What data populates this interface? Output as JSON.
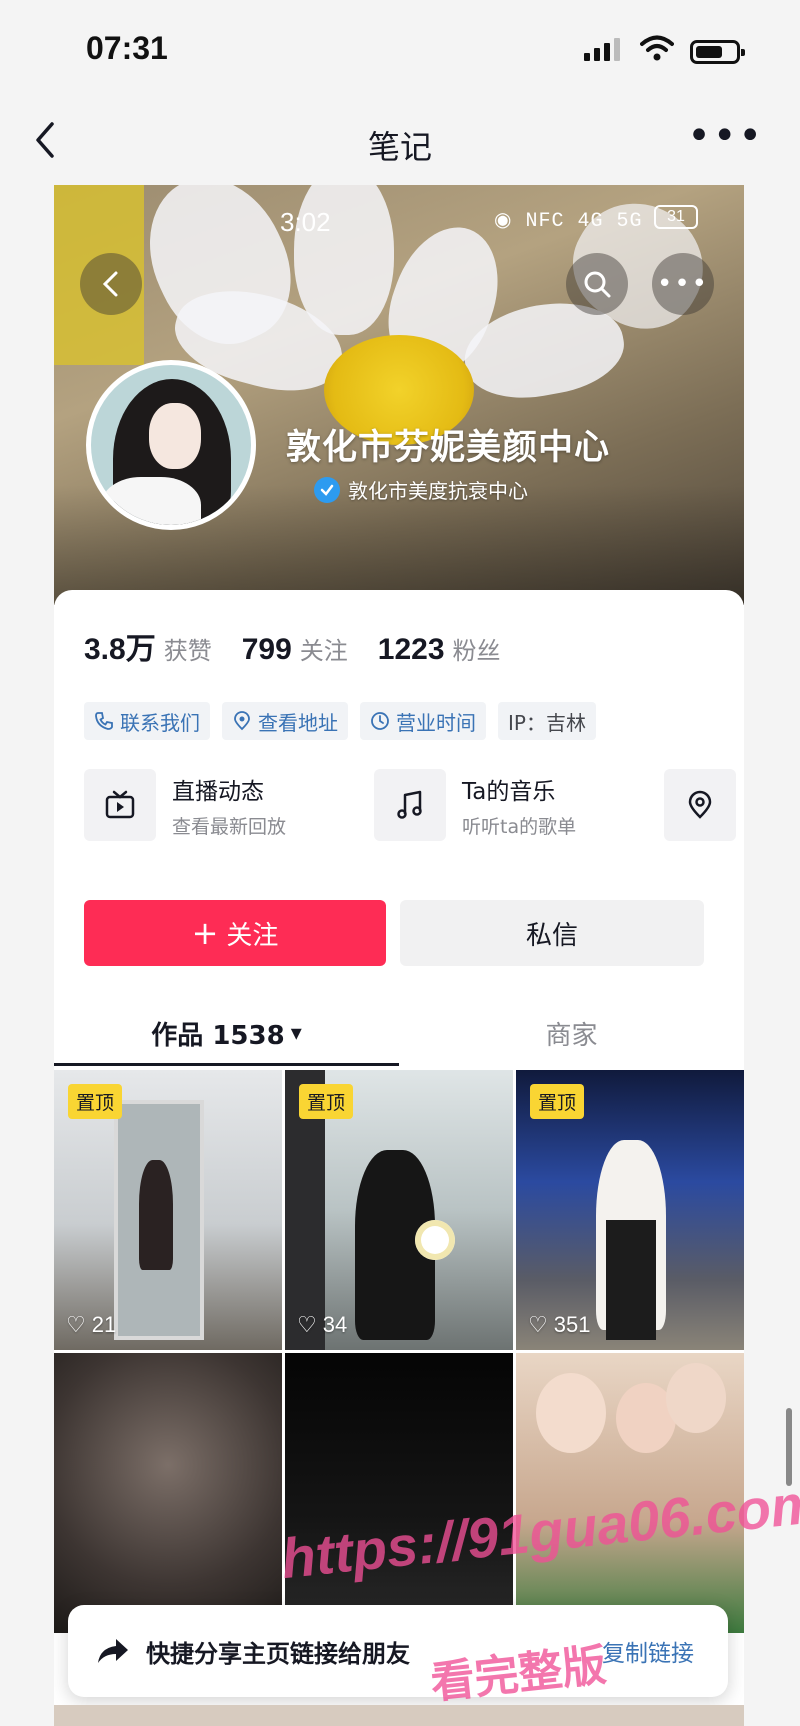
{
  "status_bar": {
    "time": "07:31"
  },
  "nav": {
    "title": "笔记"
  },
  "banner": {
    "inner_time": "3:02",
    "inner_icons": "◉ NFC 4G 5G",
    "inner_battery": "31"
  },
  "profile": {
    "name": "敦化市芬妮美颜中心",
    "verified_label": "敦化市美度抗衰中心"
  },
  "stats": [
    {
      "value": "3.8万",
      "label": "获赞"
    },
    {
      "value": "799",
      "label": "关注"
    },
    {
      "value": "1223",
      "label": "粉丝"
    }
  ],
  "chips": [
    {
      "label": "联系我们",
      "icon": "phone-icon"
    },
    {
      "label": "查看地址",
      "icon": "location-icon"
    },
    {
      "label": "营业时间",
      "icon": "clock-icon"
    },
    {
      "label": "IP：吉林"
    }
  ],
  "services": [
    {
      "title": "直播动态",
      "subtitle": "查看最新回放",
      "icon": "live-tv-icon"
    },
    {
      "title": "Ta的音乐",
      "subtitle": "听听ta的歌单",
      "icon": "music-note-icon"
    },
    {
      "icon": "location-icon"
    }
  ],
  "actions": {
    "follow": "关注",
    "follow_icon": "+",
    "message": "私信"
  },
  "tabs": {
    "works": "作品 1538",
    "works_caret": "▾",
    "merchant": "商家"
  },
  "grid": [
    {
      "pinned": "置顶",
      "likes": "21"
    },
    {
      "pinned": "置顶",
      "likes": "34"
    },
    {
      "pinned": "置顶",
      "likes": "351"
    },
    {},
    {},
    {}
  ],
  "toast": {
    "text": "快捷分享主页链接给朋友",
    "link": "复制链接"
  },
  "watermark": {
    "line1": "https://91gua06.com",
    "line2": "看完整版"
  },
  "colors": {
    "accent": "#fe2c55",
    "link": "#3a73b5",
    "pin": "#f9d533",
    "verified": "#2d9bf0"
  }
}
